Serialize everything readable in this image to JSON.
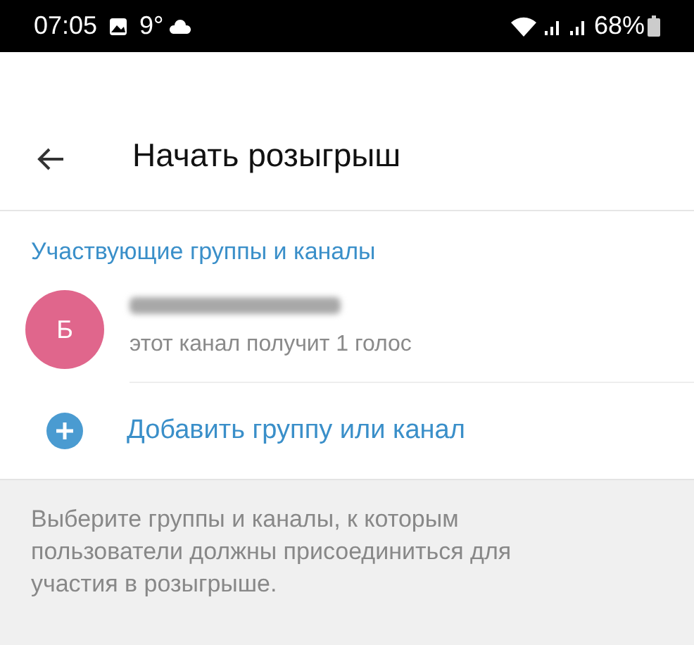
{
  "status_bar": {
    "time": "07:05",
    "temperature": "9°",
    "battery": "68%"
  },
  "header": {
    "title": "Начать розыгрыш"
  },
  "section": {
    "title": "Участвующие группы и каналы"
  },
  "channels": [
    {
      "initial": "Б",
      "color": "#e0668c",
      "subtitle": "этот канал получит 1 голос"
    }
  ],
  "add_button": {
    "label": "Добавить группу или канал"
  },
  "footer": {
    "text": "Выберите группы и каналы, к которым пользователи должны присоединиться для участия в розыгрыше."
  }
}
